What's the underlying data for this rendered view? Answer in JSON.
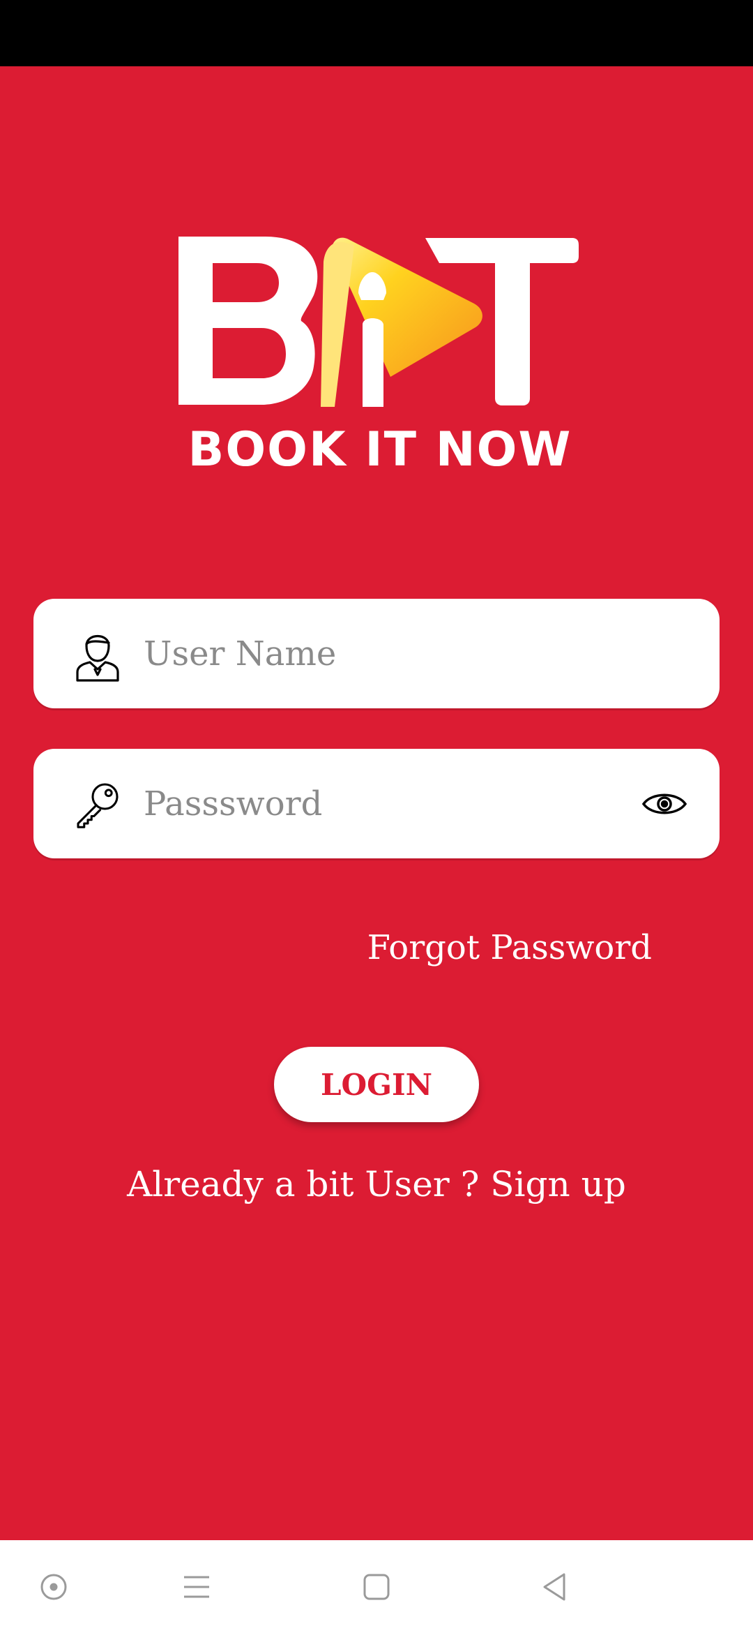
{
  "app": {
    "logo_text": "BIT",
    "tagline": "BOOK IT NOW"
  },
  "form": {
    "username_placeholder": "User Name",
    "password_placeholder": "Passsword",
    "forgot_label": "Forgot Password",
    "login_label": "LOGIN",
    "signup_prompt": "Already a bit User ? Sign up"
  },
  "icons": {
    "user": "user-icon",
    "key": "key-icon",
    "eye": "eye-icon"
  },
  "colors": {
    "brand_red": "#dc1c33",
    "logo_yellow": "#ffd21f",
    "logo_orange": "#f7931e"
  },
  "system_nav": [
    "assistant-button",
    "menu-button",
    "home-button",
    "back-button"
  ]
}
